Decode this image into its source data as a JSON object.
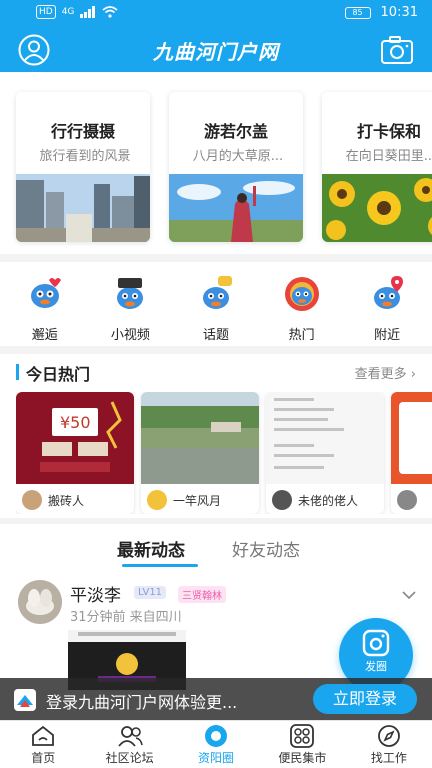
{
  "status_bar": {
    "hd": "HD",
    "signal": "4G",
    "battery": "85",
    "time": "10:31"
  },
  "header": {
    "title": "九曲河门户网"
  },
  "cards": [
    {
      "title": "行行摄摄",
      "subtitle": "旅行看到的风景"
    },
    {
      "title": "游若尔盖",
      "subtitle": "八月的大草原..."
    },
    {
      "title": "打卡保和",
      "subtitle": "在向日葵田里..."
    }
  ],
  "quick": [
    {
      "label": "邂逅"
    },
    {
      "label": "小视频"
    },
    {
      "label": "话题"
    },
    {
      "label": "热门"
    },
    {
      "label": "附近"
    }
  ],
  "hot": {
    "title": "今日热门",
    "more": "查看更多",
    "items": [
      {
        "user": "搬砖人"
      },
      {
        "user": "一竿风月"
      },
      {
        "user": "未佬的佬人"
      }
    ]
  },
  "tabs": {
    "active": "最新动态",
    "inactive": "好友动态"
  },
  "post": {
    "name": "平淡李",
    "level": "LV11",
    "rank": "三贤翰林",
    "meta": "31分钟前 来自四川"
  },
  "fab": {
    "label": "发圈"
  },
  "login_banner": {
    "text": "登录九曲河门户网体验更...",
    "button": "立即登录"
  },
  "bottom_nav": [
    {
      "label": "首页"
    },
    {
      "label": "社区论坛"
    },
    {
      "label": "资阳圈"
    },
    {
      "label": "便民集市"
    },
    {
      "label": "找工作"
    }
  ],
  "colors": {
    "accent": "#1aa6ee",
    "tag_rank": "#ee5fb2",
    "tag_level": "#8f9bd6"
  }
}
